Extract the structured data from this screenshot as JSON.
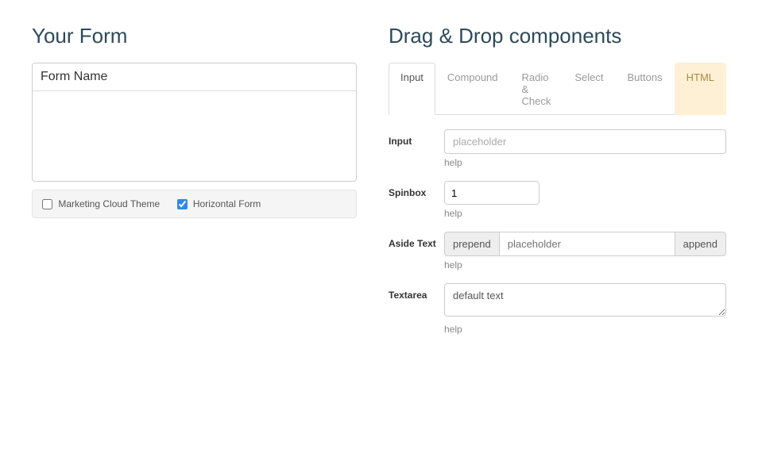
{
  "left": {
    "heading": "Your Form",
    "form_name_value": "Form Name",
    "options": {
      "marketing_label": "Marketing Cloud Theme",
      "marketing_checked": false,
      "horizontal_label": "Horizontal Form",
      "horizontal_checked": true
    }
  },
  "right": {
    "heading": "Drag & Drop components",
    "tabs": [
      {
        "label": "Input",
        "state": "active"
      },
      {
        "label": "Compound",
        "state": ""
      },
      {
        "label": "Radio & Check",
        "state": ""
      },
      {
        "label": "Select",
        "state": ""
      },
      {
        "label": "Buttons",
        "state": ""
      },
      {
        "label": "HTML",
        "state": "highlight"
      }
    ],
    "components": {
      "input": {
        "label": "Input",
        "placeholder": "placeholder",
        "help": "help"
      },
      "spinbox": {
        "label": "Spinbox",
        "value": "1",
        "help": "help"
      },
      "aside": {
        "label": "Aside Text",
        "prepend": "prepend",
        "placeholder": "placeholder",
        "append": "append",
        "help": "help"
      },
      "textarea": {
        "label": "Textarea",
        "value": "default text",
        "help": "help"
      }
    }
  }
}
